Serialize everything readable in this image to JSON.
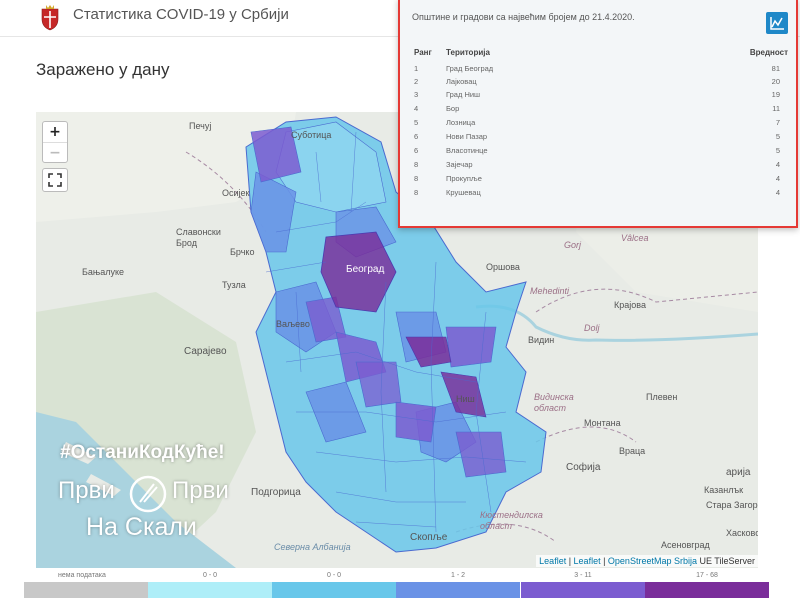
{
  "header": {
    "title": "Статистика COVID-19 у Србији",
    "logo_icon": "serbia-coat-of-arms-icon"
  },
  "section": {
    "title": "Заражено у дану"
  },
  "popup": {
    "title": "Општине и градови са највећим бројем до 21.4.2020.",
    "chart_icon": "chart-icon",
    "columns": {
      "rank": "Ранг",
      "territory": "Територија",
      "value": "Вредност"
    },
    "rows": [
      {
        "rank": "1",
        "territory": "Град Београд",
        "value": "81"
      },
      {
        "rank": "2",
        "territory": "Лајковац",
        "value": "20"
      },
      {
        "rank": "3",
        "territory": "Град Ниш",
        "value": "19"
      },
      {
        "rank": "4",
        "territory": "Бор",
        "value": "11"
      },
      {
        "rank": "5",
        "territory": "Лозница",
        "value": "7"
      },
      {
        "rank": "6",
        "territory": "Нови Пазар",
        "value": "5"
      },
      {
        "rank": "6",
        "territory": "Власотинце",
        "value": "5"
      },
      {
        "rank": "8",
        "territory": "Зајечар",
        "value": "4"
      },
      {
        "rank": "8",
        "territory": "Прокупље",
        "value": "4"
      },
      {
        "rank": "8",
        "territory": "Крушевац",
        "value": "4"
      }
    ]
  },
  "map": {
    "zoom_in": "+",
    "zoom_out": "−",
    "fullscreen_icon": "fullscreen-icon",
    "attribution": {
      "a1": "Leaflet",
      "sep": " | ",
      "a2": "Leaflet",
      "a3": "OpenStreetMap Srbija",
      "suffix": " UE TileServer"
    },
    "labels": [
      {
        "key": "pecuj",
        "text": "Печуј"
      },
      {
        "key": "subotica",
        "text": "Суботица"
      },
      {
        "key": "osijek",
        "text": "Осијек"
      },
      {
        "key": "slavonski_brod",
        "text": "Славонски\nБрод"
      },
      {
        "key": "brcko",
        "text": "Брчко"
      },
      {
        "key": "banjaluka",
        "text": "Бањалуке"
      },
      {
        "key": "tuzla",
        "text": "Тузла"
      },
      {
        "key": "sarajevo",
        "text": "Сарајево"
      },
      {
        "key": "podgorica",
        "text": "Подгорица"
      },
      {
        "key": "beograd",
        "text": "Београд"
      },
      {
        "key": "orsova",
        "text": "Оршова"
      },
      {
        "key": "mehedinti",
        "text": "Mehedinti"
      },
      {
        "key": "krajova",
        "text": "Крајова"
      },
      {
        "key": "dolj",
        "text": "Dolj"
      },
      {
        "key": "gorj",
        "text": "Gorj"
      },
      {
        "key": "valcea",
        "text": "Vâlcea"
      },
      {
        "key": "vidin",
        "text": "Видин"
      },
      {
        "key": "vidinska",
        "text": "Видинска\nобласт"
      },
      {
        "key": "montana",
        "text": "Монтана"
      },
      {
        "key": "pleven",
        "text": "Плевен"
      },
      {
        "key": "vratsa",
        "text": "Враца"
      },
      {
        "key": "sofia",
        "text": "Софија"
      },
      {
        "key": "aria",
        "text": "арија"
      },
      {
        "key": "kazanlak",
        "text": "Казанлък"
      },
      {
        "key": "zagora",
        "text": "Стара Загора"
      },
      {
        "key": "skopje",
        "text": "Скопље"
      },
      {
        "key": "kjustendil",
        "text": "Кюстендилска\nобласт"
      },
      {
        "key": "albania",
        "text": "Северна Албанија"
      },
      {
        "key": "asenovgrad",
        "text": "Асеновград"
      },
      {
        "key": "haskovo",
        "text": "Хасково"
      },
      {
        "key": "nis",
        "text": "Ниш"
      },
      {
        "key": "valjevo",
        "text": "Ваљево"
      }
    ]
  },
  "watermark": {
    "hashtag": "#ОстаниКодКуће!",
    "line1": "Први",
    "line1b": "Први",
    "line2": "На Скали"
  },
  "legend": [
    {
      "label": "нема података",
      "color": "#c8c8c8"
    },
    {
      "label": "0 - 0",
      "color": "#aeeef8"
    },
    {
      "label": "0 - 0",
      "color": "#68c7ea"
    },
    {
      "label": "1 - 2",
      "color": "#6a92e6"
    },
    {
      "label": "3 - 11",
      "color": "#7b5cd0"
    },
    {
      "label": "17 - 68",
      "color": "#7a2d9a"
    }
  ]
}
